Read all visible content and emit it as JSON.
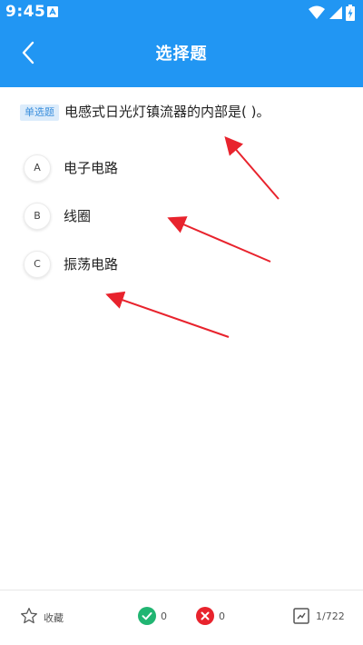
{
  "status_bar": {
    "time": "9:45"
  },
  "header": {
    "title": "选择题"
  },
  "question": {
    "tag": "单选题",
    "text": "电感式日光灯镇流器的内部是( )。"
  },
  "options": [
    {
      "letter": "A",
      "text": "电子电路"
    },
    {
      "letter": "B",
      "text": "线圈"
    },
    {
      "letter": "C",
      "text": "振荡电路"
    }
  ],
  "bottom_bar": {
    "favorite_label": "收藏",
    "correct_count": "0",
    "wrong_count": "0",
    "progress": "1/722"
  },
  "colors": {
    "header": "#2196f3",
    "correct": "#21b572",
    "wrong": "#e8232d",
    "annotation_arrow": "#e8232d"
  }
}
